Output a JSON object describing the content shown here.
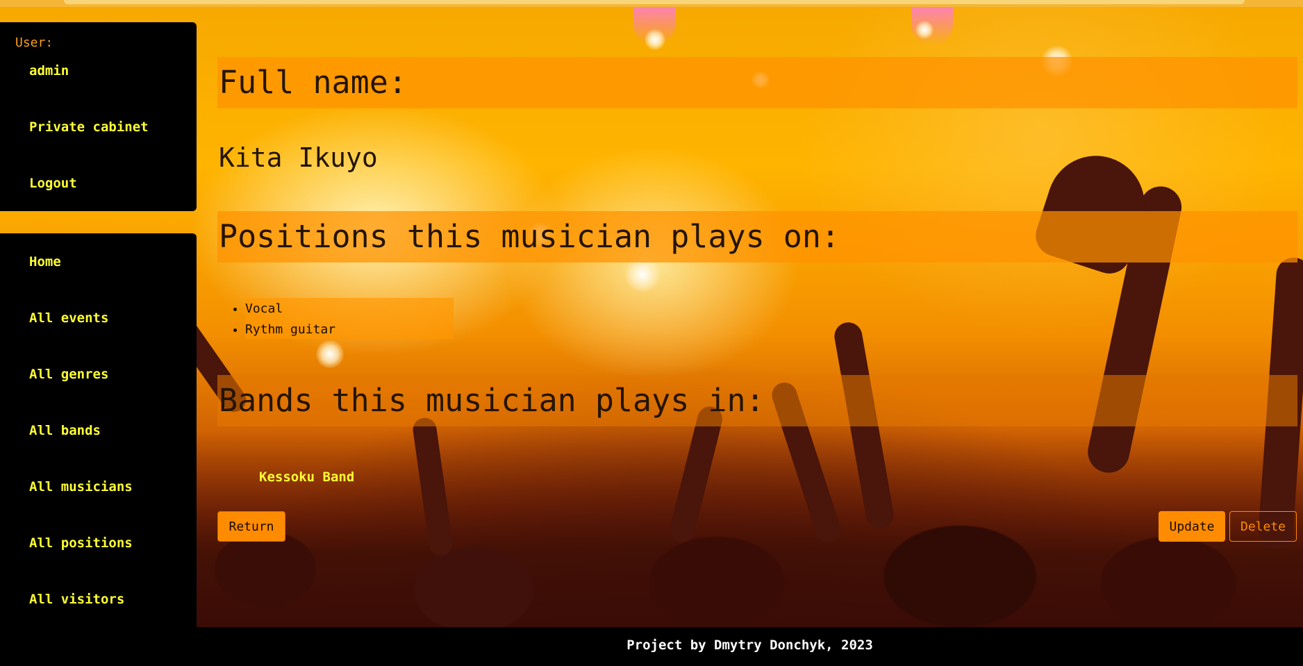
{
  "sidebar": {
    "user_label": "User:",
    "username": "admin",
    "private_cabinet": "Private cabinet",
    "logout": "Logout",
    "nav": [
      "Home",
      "All events",
      "All genres",
      "All bands",
      "All musicians",
      "All positions",
      "All visitors"
    ]
  },
  "main": {
    "full_name_heading": "Full name:",
    "full_name": "Kita Ikuyo",
    "positions_heading": "Positions this musician plays on:",
    "positions": [
      "Vocal",
      "Rythm guitar"
    ],
    "bands_heading": "Bands this musician plays in:",
    "bands": [
      "Kessoku Band"
    ]
  },
  "buttons": {
    "return": "Return",
    "update": "Update",
    "delete": "Delete"
  },
  "footer": {
    "text": "Project by Dmytry Donchyk, 2023"
  },
  "colors": {
    "link": "#ffff33",
    "accent": "#ff8c00",
    "sidebar_bg": "#000000"
  }
}
